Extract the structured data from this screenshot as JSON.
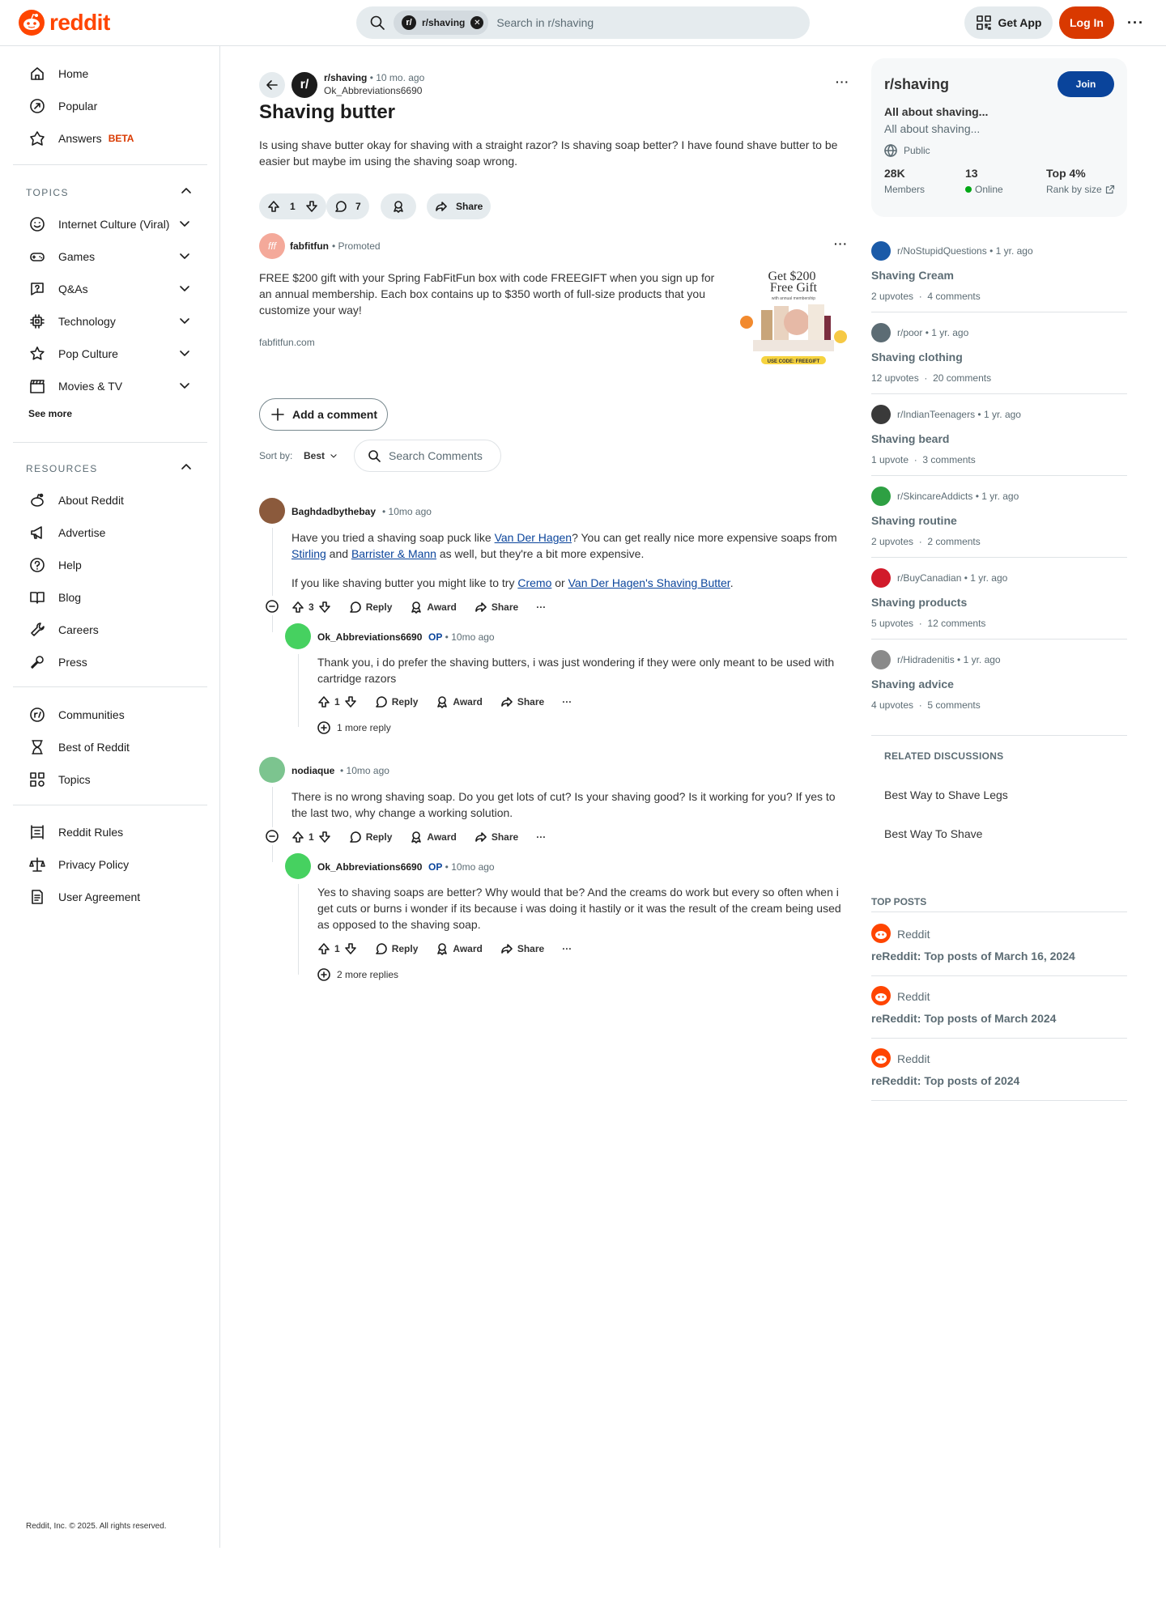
{
  "header": {
    "brand": "reddit",
    "search_chip": "r/shaving",
    "search_placeholder": "Search in r/shaving",
    "get_app": "Get App",
    "login": "Log In",
    "more": "···"
  },
  "nav": {
    "primary": [
      {
        "label": "Home",
        "icon": "home-icon"
      },
      {
        "label": "Popular",
        "icon": "popular-icon"
      },
      {
        "label": "Answers",
        "icon": "answers-icon",
        "badge": "BETA"
      }
    ],
    "topics_label": "TOPICS",
    "topics": [
      {
        "label": "Internet Culture (Viral)",
        "icon": "smile-icon"
      },
      {
        "label": "Games",
        "icon": "gamepad-icon"
      },
      {
        "label": "Q&As",
        "icon": "question-bubble-icon"
      },
      {
        "label": "Technology",
        "icon": "chip-icon"
      },
      {
        "label": "Pop Culture",
        "icon": "star-icon"
      },
      {
        "label": "Movies & TV",
        "icon": "clapper-icon"
      }
    ],
    "see_more": "See more",
    "resources_label": "RESOURCES",
    "resources": [
      {
        "label": "About Reddit",
        "icon": "reddit-alien-icon"
      },
      {
        "label": "Advertise",
        "icon": "megaphone-icon"
      },
      {
        "label": "Help",
        "icon": "help-icon"
      },
      {
        "label": "Blog",
        "icon": "book-icon"
      },
      {
        "label": "Careers",
        "icon": "wrench-icon"
      },
      {
        "label": "Press",
        "icon": "microphone-icon"
      }
    ],
    "communities": [
      {
        "label": "Communities",
        "icon": "communities-icon"
      },
      {
        "label": "Best of Reddit",
        "icon": "hourglass-icon"
      },
      {
        "label": "Topics",
        "icon": "topics-grid-icon"
      }
    ],
    "legal": [
      {
        "label": "Reddit Rules",
        "icon": "rules-icon"
      },
      {
        "label": "Privacy Policy",
        "icon": "scales-icon"
      },
      {
        "label": "User Agreement",
        "icon": "document-icon"
      }
    ],
    "copyright": "Reddit, Inc. © 2025. All rights reserved."
  },
  "post": {
    "subreddit": "r/shaving",
    "time": "10 mo. ago",
    "author": "Ok_Abbreviations6690",
    "title": "Shaving butter",
    "body": "Is using shave butter okay for shaving with a straight razor? Is shaving soap better? I have found shave butter to be easier but maybe im using the shaving soap wrong.",
    "votes": "1",
    "comments": "7",
    "share": "Share"
  },
  "ad": {
    "advertiser": "fabfitfun",
    "promoted": "Promoted",
    "text": "FREE $200 gift with your Spring FabFitFun box with code FREEGIFT when you sign up for an annual membership. Each box contains up to $350 worth of full-size products that you customize your way!",
    "domain": "fabfitfun.com",
    "image_headline": "Get $200 Free Gift",
    "image_sub": "with annual membership",
    "image_code": "USE CODE: FREEGIFT"
  },
  "comments_ui": {
    "add_comment": "Add a comment",
    "sort_label": "Sort by:",
    "sort_value": "Best",
    "search_comments": "Search Comments"
  },
  "comments": [
    {
      "author": "Baghdadbythebay",
      "time": "10mo ago",
      "p1_a": "Have you tried a shaving soap puck like ",
      "p1_link1": "Van Der Hagen",
      "p1_b": "? You can get really nice more expensive soaps from ",
      "p1_link2": "Stirling",
      "p1_c": " and ",
      "p1_link3": "Barrister & Mann",
      "p1_d": " as well, but they're a bit more expensive.",
      "p2_a": "If you like shaving butter you might like to try ",
      "p2_link1": "Cremo",
      "p2_b": " or ",
      "p2_link2": "Van Der Hagen's Shaving Butter",
      "p2_c": ".",
      "votes": "3",
      "reply": "Reply",
      "award": "Award",
      "share": "Share",
      "child": {
        "author": "Ok_Abbreviations6690",
        "op": "OP",
        "time": "10mo ago",
        "text": "Thank you, i do prefer the shaving butters, i was just wondering if they were only meant to be used with cartridge razors",
        "votes": "1",
        "more": "1 more reply"
      }
    },
    {
      "author": "nodiaque",
      "time": "10mo ago",
      "text": "There is no wrong shaving soap. Do you get lots of cut? Is your shaving good? Is it working for you? If yes to the last two, why change a working solution.",
      "votes": "1",
      "child": {
        "author": "Ok_Abbreviations6690",
        "op": "OP",
        "time": "10mo ago",
        "text": "Yes to shaving soaps are better? Why would that be? And the creams do work but every so often when i get cuts or burns i wonder if its because i was doing it hastily or it was the result of the cream being used as opposed to the shaving soap.",
        "votes": "1",
        "more": "2 more replies"
      }
    }
  ],
  "sidebar": {
    "name": "r/shaving",
    "join": "Join",
    "headline": "All about shaving...",
    "desc": "All about shaving...",
    "visibility": "Public",
    "members": "28K",
    "members_label": "Members",
    "online": "13",
    "online_label": "Online",
    "rank": "Top 4%",
    "rank_label": "Rank by size",
    "related": [
      {
        "sub": "r/NoStupidQuestions",
        "age": "1 yr. ago",
        "title": "Shaving Cream",
        "upvotes": "2 upvotes",
        "comments": "4 comments",
        "color": "#1a5aa8"
      },
      {
        "sub": "r/poor",
        "age": "1 yr. ago",
        "title": "Shaving clothing",
        "upvotes": "12 upvotes",
        "comments": "20 comments",
        "color": "#5c6c74"
      },
      {
        "sub": "r/IndianTeenagers",
        "age": "1 yr. ago",
        "title": "Shaving beard",
        "upvotes": "1 upvote",
        "comments": "3 comments",
        "color": "#3a3a3a"
      },
      {
        "sub": "r/SkincareAddicts",
        "age": "1 yr. ago",
        "title": "Shaving routine",
        "upvotes": "2 upvotes",
        "comments": "2 comments",
        "color": "#2ea043"
      },
      {
        "sub": "r/BuyCanadian",
        "age": "1 yr. ago",
        "title": "Shaving products",
        "upvotes": "5 upvotes",
        "comments": "12 comments",
        "color": "#d11a2a"
      },
      {
        "sub": "r/Hidradenitis",
        "age": "1 yr. ago",
        "title": "Shaving advice",
        "upvotes": "4 upvotes",
        "comments": "5 comments",
        "color": "#8a8a8a"
      }
    ],
    "related_discussions_label": "RELATED DISCUSSIONS",
    "discussions": [
      "Best Way to Shave Legs",
      "Best Way To Shave"
    ],
    "top_posts_label": "TOP POSTS",
    "top_posts": [
      {
        "name": "Reddit",
        "title": "reReddit: Top posts of March 16, 2024"
      },
      {
        "name": "Reddit",
        "title": "reReddit: Top posts of March 2024"
      },
      {
        "name": "Reddit",
        "title": "reReddit: Top posts of 2024"
      }
    ]
  }
}
